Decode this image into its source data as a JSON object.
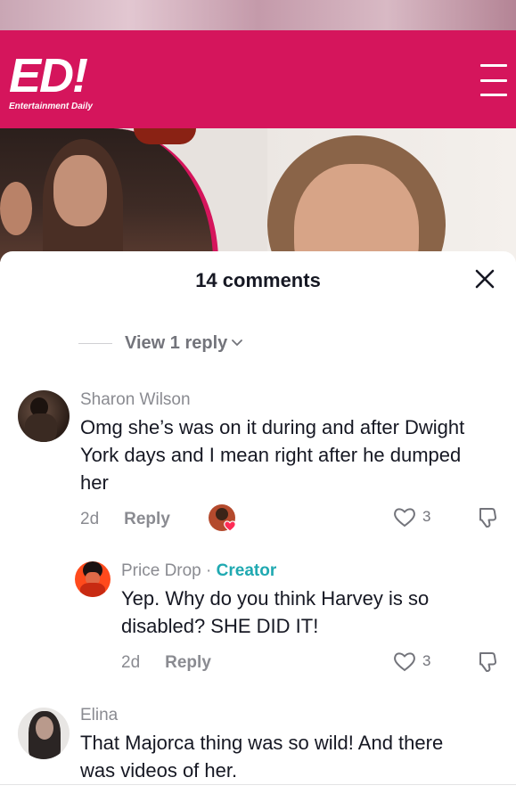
{
  "header": {
    "logo": "ED!",
    "logo_subtitle": "Entertainment Daily"
  },
  "sheet": {
    "title": "14 comments",
    "view_reply": "View 1 reply"
  },
  "comments": [
    {
      "username": "Sharon Wilson",
      "text": "Omg she’s was on it during and after Dwight York days and I mean right after he dumped her",
      "age": "2d",
      "reply_label": "Reply",
      "likes": "3"
    },
    {
      "username": "Price Drop",
      "separator": " · ",
      "badge": "Creator",
      "text": "Yep. Why do you think Harvey is so disabled? SHE DID IT!",
      "age": "2d",
      "reply_label": "Reply",
      "likes": "3"
    },
    {
      "username": "Elina",
      "text": "That Majorca thing was so wild! And there was videos of her."
    }
  ],
  "colors": {
    "brand": "#d5155c",
    "creator": "#20a9b1",
    "muted": "#8a8b91",
    "heart": "#fe2c55"
  },
  "icons": [
    "menu-icon",
    "close-icon",
    "chevron-down-icon",
    "heart-icon",
    "dislike-icon"
  ]
}
